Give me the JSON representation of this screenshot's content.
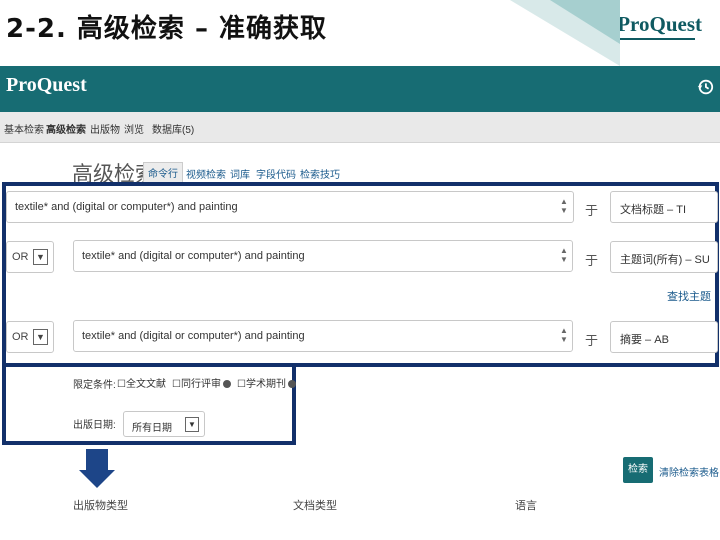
{
  "slide": {
    "title": "2-2. 高级检索 – 准确获取",
    "corner_logo": "ProQuest"
  },
  "app": {
    "brand": "ProQuest",
    "nav": [
      "基本检索",
      "高级检索",
      "出版物",
      "浏览",
      "数据库(5)"
    ]
  },
  "search": {
    "heading": "高级检索",
    "tabs": [
      "命令行",
      "视频检索",
      "词库",
      "字段代码",
      "检索技巧"
    ],
    "active_tab": 0,
    "rows": [
      {
        "operator": "",
        "query": "textile* and (digital or computer*) and painting",
        "connector": "于",
        "field": "文档标题 – TI"
      },
      {
        "operator": "OR",
        "query": "textile* and (digital or computer*) and painting",
        "connector": "于",
        "field": "主题词(所有) – SU"
      },
      {
        "operator": "OR",
        "query": "textile* and (digital or computer*) and painting",
        "connector": "于",
        "field": "摘要 – AB"
      }
    ],
    "find_subject": "查找主题"
  },
  "limits": {
    "label": "限定条件:",
    "options": [
      "全文文献",
      "同行评审",
      "学术期刊"
    ],
    "date_label": "出版日期:",
    "date_value": "所有日期"
  },
  "actions": {
    "search": "检索",
    "clear": "清除检索表格"
  },
  "sections": [
    "出版物类型",
    "文档类型",
    "语言"
  ],
  "colors": {
    "brand_teal": "#176c73",
    "frame_navy": "#12306a"
  }
}
